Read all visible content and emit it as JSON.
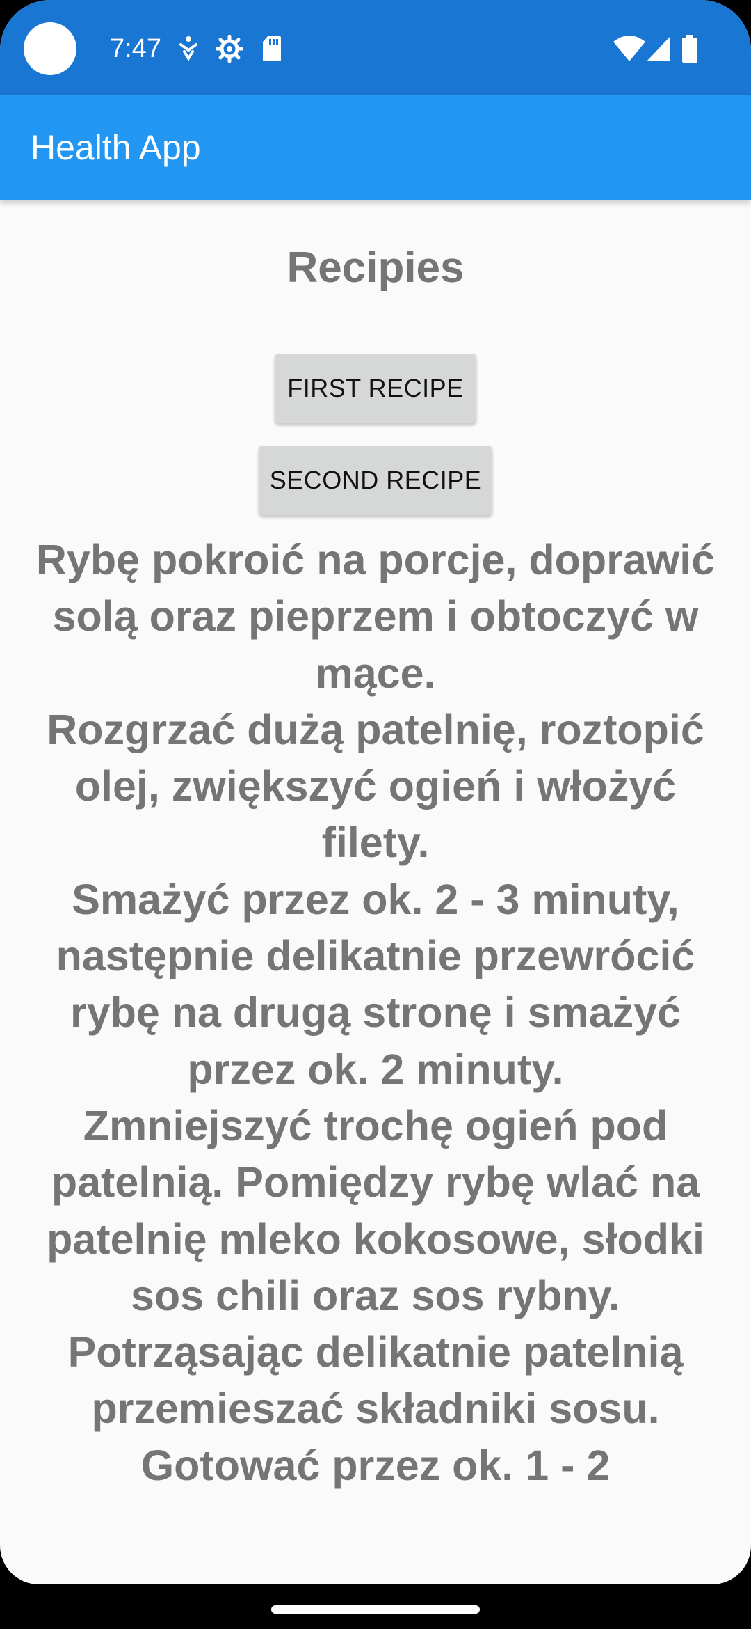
{
  "status_bar": {
    "time": "7:47",
    "icons_left": [
      "accessibility-icon",
      "settings-gear-icon",
      "sd-card-icon"
    ],
    "icons_right": [
      "wifi-icon",
      "cell-signal-icon",
      "battery-icon"
    ],
    "background": "#1976D2"
  },
  "app_bar": {
    "title": "Health App",
    "background": "#2196F3"
  },
  "page": {
    "title": "Recipies",
    "buttons": {
      "first": "FIRST RECIPE",
      "second": "SECOND RECIPE"
    },
    "recipe_text": "Rybę pokroić na porcje, doprawić solą oraz pieprzem i obtoczyć w mące.\nRozgrzać dużą patelnię, roztopić olej, zwiększyć ogień i włożyć filety.\nSmażyć przez ok. 2 - 3 minuty, następnie delikatnie przewrócić rybę na drugą stronę i smażyć przez ok. 2 minuty.\nZmniejszyć trochę ogień pod patelnią. Pomiędzy rybę wlać na patelnię mleko kokosowe, słodki sos chili oraz sos rybny. Potrząsając delikatnie patelnią przemieszać składniki sosu.\nGotować przez ok. 1 - 2"
  },
  "colors": {
    "text_grey": "#757575",
    "button_bg": "#D6D7D7",
    "page_bg": "#FAFAFA"
  }
}
